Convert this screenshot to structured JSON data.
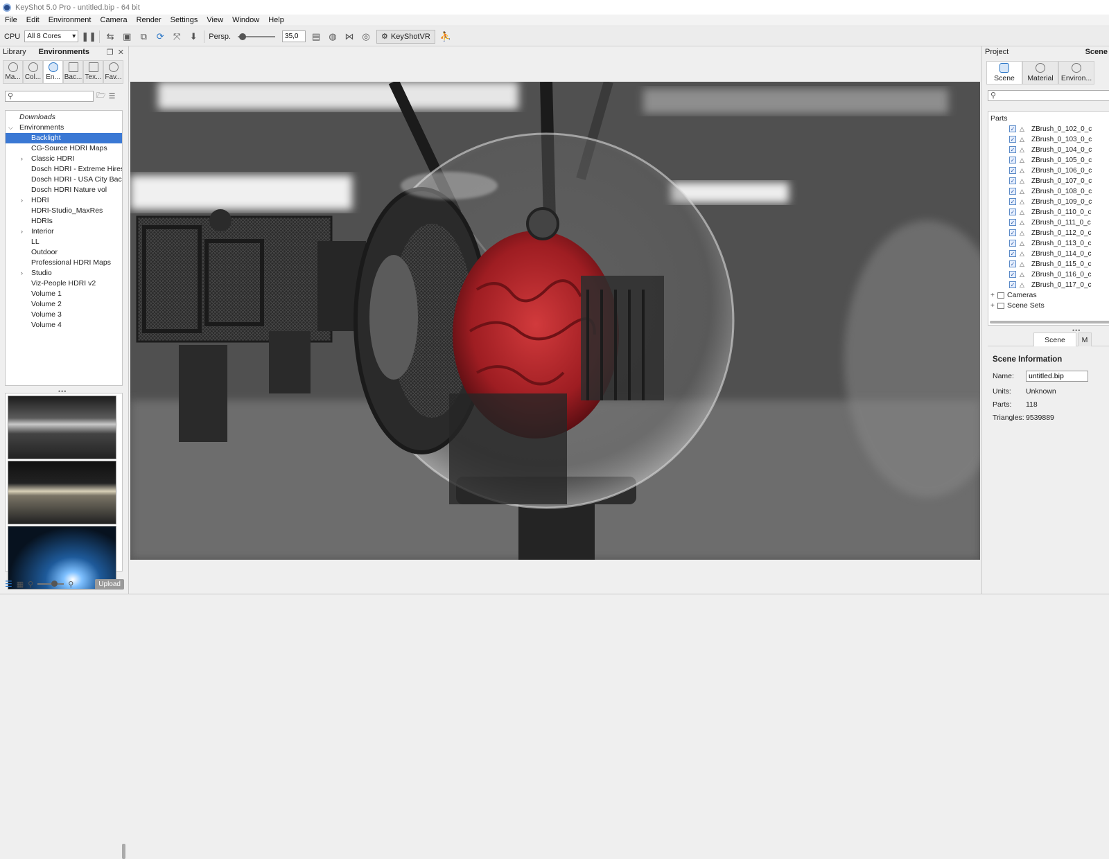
{
  "window": {
    "title": "KeyShot 5.0 Pro - untitled.bip - 64 bit"
  },
  "menu": [
    "File",
    "Edit",
    "Environment",
    "Camera",
    "Render",
    "Settings",
    "View",
    "Window",
    "Help"
  ],
  "toolbar": {
    "cpu_label": "CPU",
    "cores_value": "All 8 Cores",
    "persp_label": "Persp.",
    "fov_value": "35,0",
    "vr_label": "KeyShotVR"
  },
  "library": {
    "label": "Library",
    "title": "Environments",
    "tabs": [
      "Ma...",
      "Col...",
      "En...",
      "Bac...",
      "Tex...",
      "Fav..."
    ],
    "tree": [
      {
        "label": "Downloads",
        "indent": 0,
        "italic": true
      },
      {
        "label": "Environments",
        "indent": 0,
        "expander": "open"
      },
      {
        "label": "Backlight",
        "indent": 1,
        "selected": true
      },
      {
        "label": "CG-Source HDRI Maps",
        "indent": 1
      },
      {
        "label": "Classic HDRI",
        "indent": 1,
        "expander": "closed"
      },
      {
        "label": "Dosch HDRI - Extreme Hires",
        "indent": 1
      },
      {
        "label": "Dosch HDRI - USA City Bac...",
        "indent": 1
      },
      {
        "label": "Dosch HDRI Nature vol",
        "indent": 1
      },
      {
        "label": "HDRI",
        "indent": 1,
        "expander": "closed"
      },
      {
        "label": "HDRI-Studio_MaxRes",
        "indent": 1
      },
      {
        "label": "HDRIs",
        "indent": 1
      },
      {
        "label": "Interior",
        "indent": 1,
        "expander": "closed"
      },
      {
        "label": "LL",
        "indent": 1
      },
      {
        "label": "Outdoor",
        "indent": 1
      },
      {
        "label": "Professional HDRI Maps",
        "indent": 1
      },
      {
        "label": "Studio",
        "indent": 1,
        "expander": "closed"
      },
      {
        "label": "Viz-People HDRI v2",
        "indent": 1
      },
      {
        "label": "Volume 1",
        "indent": 1
      },
      {
        "label": "Volume 2",
        "indent": 1
      },
      {
        "label": "Volume 3",
        "indent": 1
      },
      {
        "label": "Volume 4",
        "indent": 1
      }
    ],
    "upload_label": "Upload"
  },
  "project": {
    "label": "Project",
    "title": "Scene",
    "tabs": [
      "Scene",
      "Material",
      "Environ..."
    ],
    "parts_title": "Parts",
    "parts": [
      "ZBrush_0_102_0_c",
      "ZBrush_0_103_0_c",
      "ZBrush_0_104_0_c",
      "ZBrush_0_105_0_c",
      "ZBrush_0_106_0_c",
      "ZBrush_0_107_0_c",
      "ZBrush_0_108_0_c",
      "ZBrush_0_109_0_c",
      "ZBrush_0_110_0_c",
      "ZBrush_0_111_0_c",
      "ZBrush_0_112_0_c",
      "ZBrush_0_113_0_c",
      "ZBrush_0_114_0_c",
      "ZBrush_0_115_0_c",
      "ZBrush_0_116_0_c",
      "ZBrush_0_117_0_c"
    ],
    "groups": [
      "Cameras",
      "Scene Sets"
    ],
    "sub_tab": "Scene",
    "sub_tab_2": "M",
    "info": {
      "title": "Scene Information",
      "name_label": "Name:",
      "name_value": "untitled.bip",
      "units_label": "Units:",
      "units_value": "Unknown",
      "parts_label": "Parts:",
      "parts_value": "118",
      "triangles_label": "Triangles:",
      "triangles_value": "9539889"
    }
  }
}
